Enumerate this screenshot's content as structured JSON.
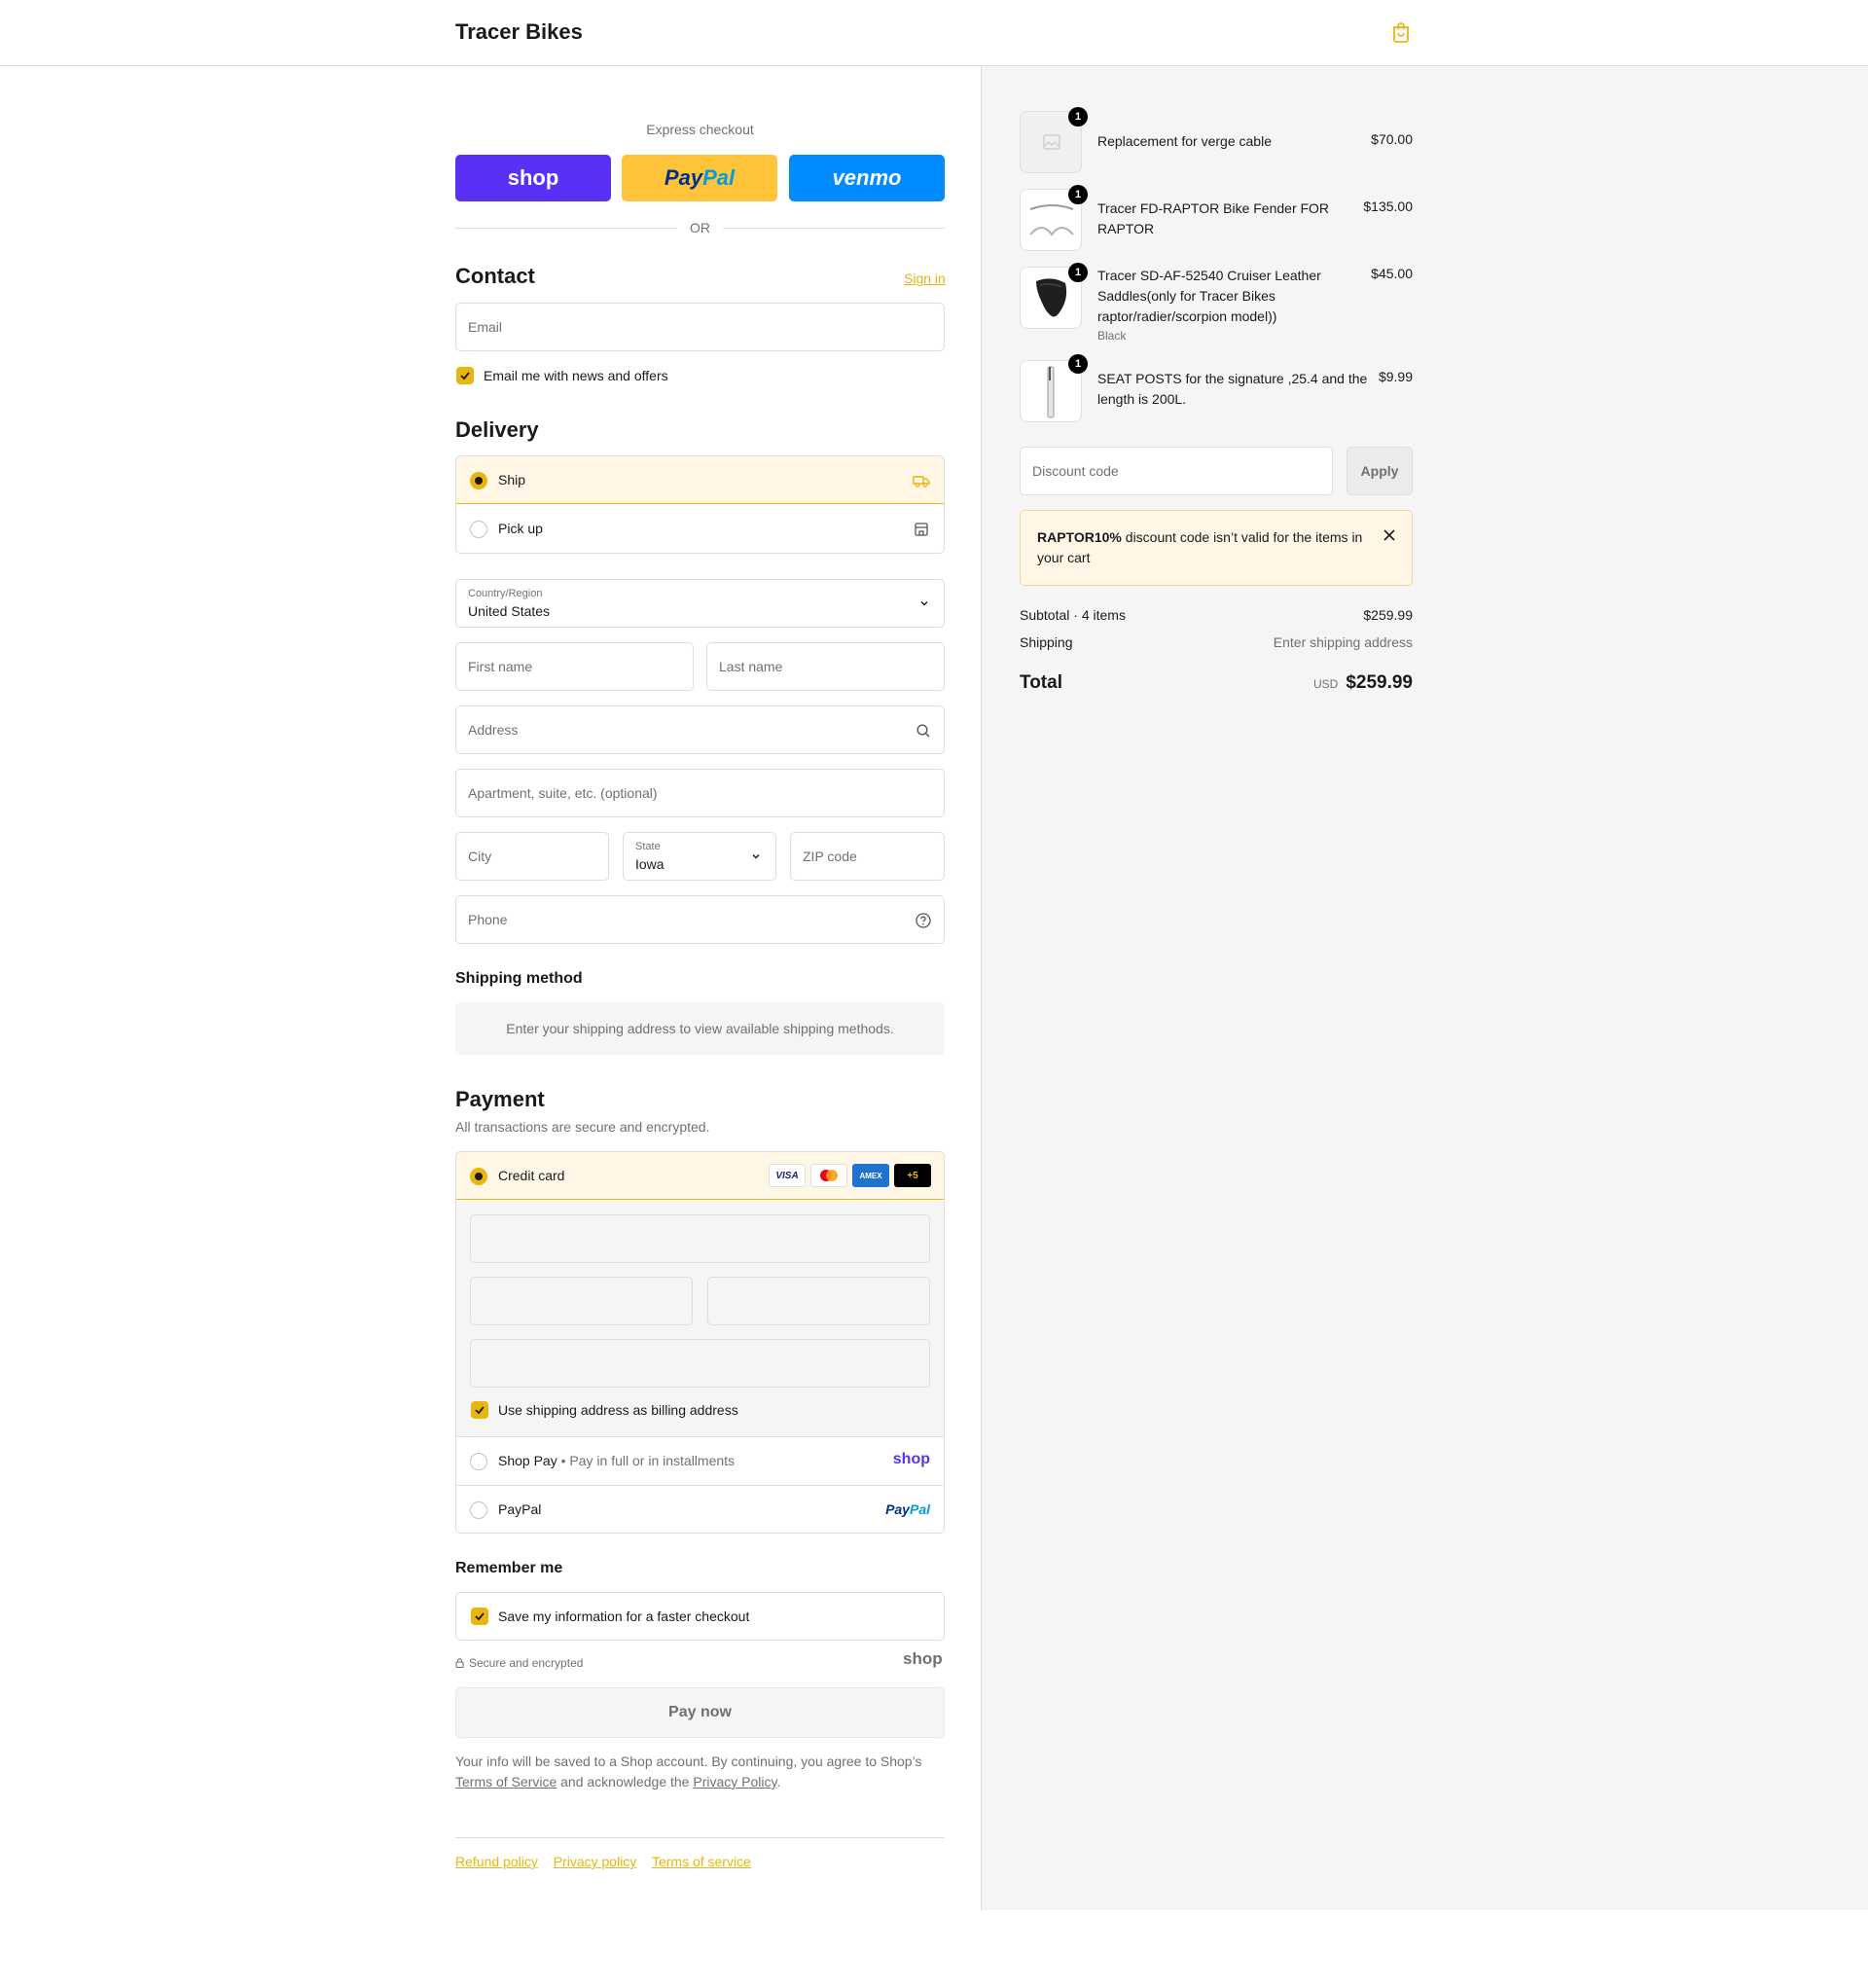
{
  "header": {
    "store_name": "Tracer Bikes"
  },
  "express": {
    "label": "Express checkout",
    "shop_label": "shop",
    "paypal_a": "Pay",
    "paypal_b": "Pal",
    "venmo_label": "venmo",
    "or_label": "OR"
  },
  "contact": {
    "title": "Contact",
    "sign_in": "Sign in",
    "email_placeholder": "Email",
    "news_label": "Email me with news and offers"
  },
  "delivery": {
    "title": "Delivery",
    "ship_label": "Ship",
    "pickup_label": "Pick up",
    "country_label": "Country/Region",
    "country_value": "United States",
    "first_name": "First name",
    "last_name": "Last name",
    "address": "Address",
    "apartment": "Apartment, suite, etc. (optional)",
    "city": "City",
    "state_label": "State",
    "state_value": "Iowa",
    "zip": "ZIP code",
    "phone": "Phone"
  },
  "shipping_method": {
    "title": "Shipping method",
    "message": "Enter your shipping address to view available shipping methods."
  },
  "payment": {
    "title": "Payment",
    "subtitle": "All transactions are secure and encrypted.",
    "credit_card_label": "Credit card",
    "card_badges": [
      "VISA",
      "",
      "AMEX",
      "+5"
    ],
    "billing_label": "Use shipping address as billing address",
    "shop_pay_label": "Shop Pay",
    "shop_pay_sub": "Pay in full or in installments",
    "shop_logo": "shop",
    "paypal_label": "PayPal",
    "paypal_logo_a": "Pay",
    "paypal_logo_b": "Pal"
  },
  "remember": {
    "title": "Remember me",
    "save_label": "Save my information for a faster checkout",
    "secure_label": "Secure and encrypted",
    "shop_logo": "shop"
  },
  "pay_now_label": "Pay now",
  "legal": {
    "text1": "Your info will be saved to a Shop account. By continuing, you agree to Shop’s",
    "tos": "Terms of Service",
    "text2": "and acknowledge the",
    "privacy": "Privacy Policy",
    "text3": "."
  },
  "footer_links": [
    "Refund policy",
    "Privacy policy",
    "Terms of service"
  ],
  "cart": {
    "items": [
      {
        "name": "Replacement for verge cable",
        "price": "$70.00",
        "qty": "1",
        "variant": ""
      },
      {
        "name": "Tracer FD-RAPTOR Bike Fender FOR RAPTOR",
        "price": "$135.00",
        "qty": "1",
        "variant": ""
      },
      {
        "name": "Tracer SD-AF-52540 Cruiser Leather Saddles(only for Tracer Bikes raptor/radier/scorpion model))",
        "price": "$45.00",
        "qty": "1",
        "variant": "Black"
      },
      {
        "name": "SEAT POSTS for the signature ,25.4 and the length is 200L.",
        "price": "$9.99",
        "qty": "1",
        "variant": ""
      }
    ],
    "discount_placeholder": "Discount code",
    "apply_label": "Apply",
    "error_code": "RAPTOR10%",
    "error_text": " discount code isn’t valid for the items in your cart",
    "subtotal_label": "Subtotal · 4 items",
    "subtotal_value": "$259.99",
    "shipping_label": "Shipping",
    "shipping_value": "Enter shipping address",
    "total_label": "Total",
    "currency": "USD",
    "total_value": "$259.99"
  },
  "colors": {
    "accent": "#e8b60c",
    "shop_purple": "#5a31f4",
    "paypal_yellow": "#ffc439",
    "venmo_blue": "#008cff"
  }
}
